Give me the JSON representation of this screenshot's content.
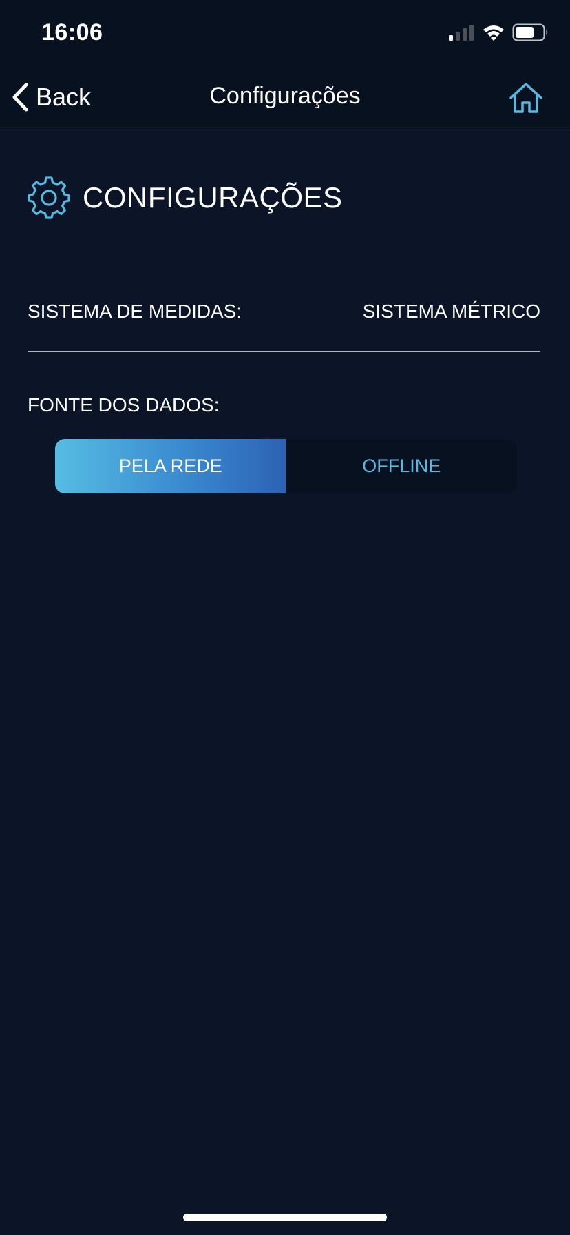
{
  "status_bar": {
    "time": "16:06",
    "icons": [
      "cellular-signal-icon",
      "wifi-icon",
      "battery-icon"
    ]
  },
  "nav": {
    "back_label": "Back",
    "title": "Configurações",
    "home_icon": "home-icon"
  },
  "section": {
    "icon": "gear-icon",
    "title": "CONFIGURAÇÕES"
  },
  "settings": {
    "measure_label": "SISTEMA DE MEDIDAS:",
    "measure_value": "SISTEMA MÉTRICO",
    "source_label": "FONTE DOS DADOS:",
    "source_options": [
      "PELA REDE",
      "OFFLINE"
    ],
    "source_selected": "PELA REDE"
  },
  "colors": {
    "background": "#0b1527",
    "bar_background": "#08111f",
    "accent": "#58b8e0",
    "gradient_start": "#56bde3",
    "gradient_end": "#2d62b3"
  }
}
